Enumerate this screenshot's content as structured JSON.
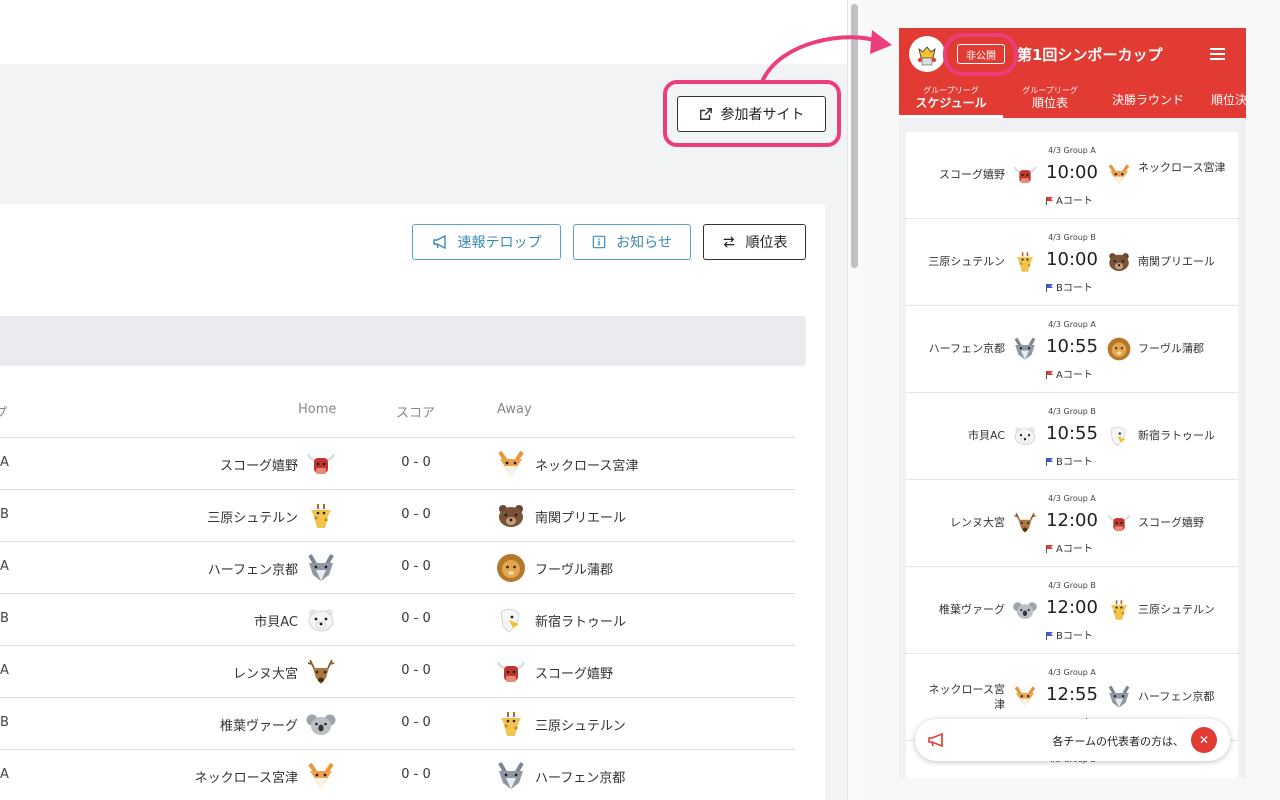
{
  "admin": {
    "participant_site_button": "参加者サイト",
    "toolbar": {
      "ticker_button": "速報テロップ",
      "news_button": "お知らせ",
      "standings_button": "順位表"
    },
    "table": {
      "headers": {
        "group": "ープ",
        "home": "Home",
        "score": "スコア",
        "away": "Away"
      },
      "rows": [
        {
          "group": "A",
          "home": "スコーグ嬉野",
          "home_icon": "bull-icon",
          "score": "0 - 0",
          "away": "ネックロース宮津",
          "away_icon": "fox-icon"
        },
        {
          "group": "B",
          "home": "三原シュテルン",
          "home_icon": "giraffe-icon",
          "score": "0 - 0",
          "away": "南関プリエール",
          "away_icon": "bear-icon"
        },
        {
          "group": "A",
          "home": "ハーフェン京都",
          "home_icon": "wolf-icon",
          "score": "0 - 0",
          "away": "フーヴル蒲郡",
          "away_icon": "lion-icon"
        },
        {
          "group": "B",
          "home": "市貝AC",
          "home_icon": "polar-bear-icon",
          "score": "0 - 0",
          "away": "新宿ラトゥール",
          "away_icon": "eagle-icon"
        },
        {
          "group": "A",
          "home": "レンヌ大宮",
          "home_icon": "deer-icon",
          "score": "0 - 0",
          "away": "スコーグ嬉野",
          "away_icon": "bull-icon"
        },
        {
          "group": "B",
          "home": "椎葉ヴァーグ",
          "home_icon": "koala-icon",
          "score": "0 - 0",
          "away": "三原シュテルン",
          "away_icon": "giraffe-icon"
        },
        {
          "group": "A",
          "home": "ネックロース宮津",
          "home_icon": "fox-icon",
          "score": "0 - 0",
          "away": "ハーフェン京都",
          "away_icon": "wolf-icon"
        }
      ]
    }
  },
  "preview": {
    "private_badge": "非公開",
    "event_title": "第1回シンポーカップ",
    "tabs": [
      {
        "sub": "グループリーグ",
        "label": "スケジュール",
        "active": true
      },
      {
        "sub": "グループリーグ",
        "label": "順位表",
        "active": false
      },
      {
        "sub": "",
        "label": "決勝ラウンド",
        "active": false
      },
      {
        "sub": "",
        "label": "順位決",
        "active": false
      }
    ],
    "matches": [
      {
        "date_group": "4/3  Group A",
        "time": "10:00",
        "court": "Aコート",
        "court_color": "#e23b33",
        "home": "スコーグ嬉野",
        "home_icon": "bull-icon",
        "away": "ネックロース宮津",
        "away_icon": "fox-icon"
      },
      {
        "date_group": "4/3  Group B",
        "time": "10:00",
        "court": "Bコート",
        "court_color": "#3f5bd6",
        "home": "三原シュテルン",
        "home_icon": "giraffe-icon",
        "away": "南関プリエール",
        "away_icon": "bear-icon"
      },
      {
        "date_group": "4/3  Group A",
        "time": "10:55",
        "court": "Aコート",
        "court_color": "#e23b33",
        "home": "ハーフェン京都",
        "home_icon": "wolf-icon",
        "away": "フーヴル蒲郡",
        "away_icon": "lion-icon"
      },
      {
        "date_group": "4/3  Group B",
        "time": "10:55",
        "court": "Bコート",
        "court_color": "#3f5bd6",
        "home": "市貝AC",
        "home_icon": "polar-bear-icon",
        "away": "新宿ラトゥール",
        "away_icon": "eagle-icon"
      },
      {
        "date_group": "4/3  Group A",
        "time": "12:00",
        "court": "Aコート",
        "court_color": "#e23b33",
        "home": "レンヌ大宮",
        "home_icon": "deer-icon",
        "away": "スコーグ嬉野",
        "away_icon": "bull-icon"
      },
      {
        "date_group": "4/3  Group B",
        "time": "12:00",
        "court": "Bコート",
        "court_color": "#3f5bd6",
        "home": "椎葉ヴァーグ",
        "home_icon": "koala-icon",
        "away": "三原シュテルン",
        "away_icon": "giraffe-icon"
      },
      {
        "date_group": "4/3  Group A",
        "time": "12:55",
        "court": "Aコート",
        "court_color": "#e23b33",
        "home": "ネックロース宮津",
        "home_icon": "fox-icon",
        "away": "ハーフェン京都",
        "away_icon": "wolf-icon"
      },
      {
        "date_group": "4/3  Group B",
        "time": "",
        "court": "",
        "court_color": "#3f5bd6",
        "home": "",
        "home_icon": "",
        "away": "",
        "away_icon": ""
      }
    ],
    "toast_text": "各チームの代表者の方は、",
    "accent_color": "#e23b33",
    "highlight_color": "#ec3d7c"
  }
}
